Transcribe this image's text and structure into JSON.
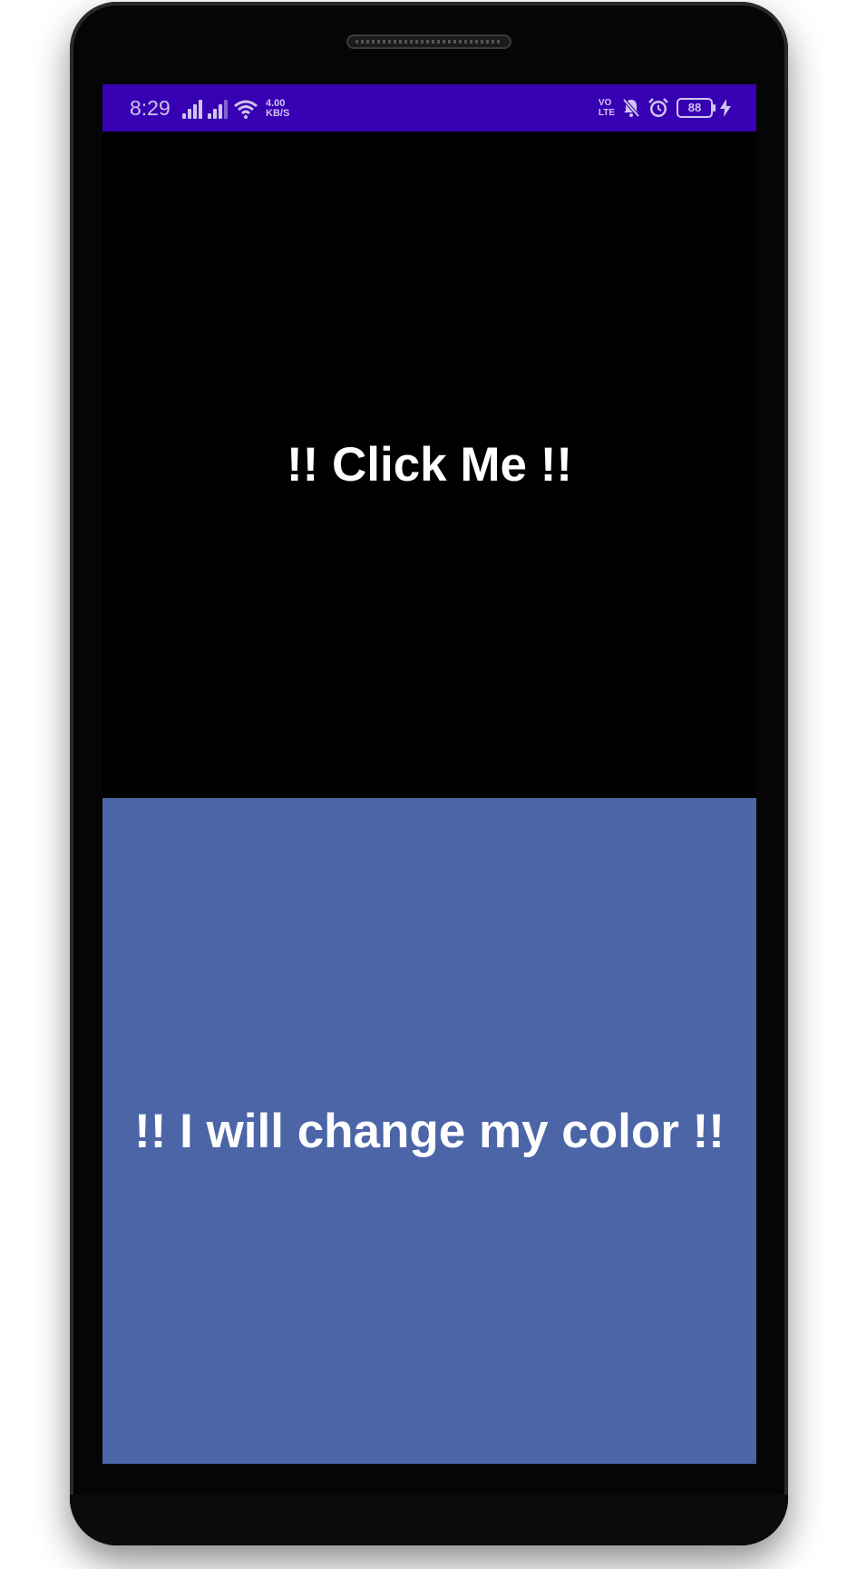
{
  "status_bar": {
    "time": "8:29",
    "net_speed_value": "4.00",
    "net_speed_unit": "KB/S",
    "volte_line1": "VO",
    "volte_line2": "LTE",
    "battery_level": "88",
    "icons": [
      "signal-icon",
      "signal-icon",
      "wifi-icon",
      "volte-icon",
      "mute-bell-icon",
      "alarm-icon",
      "battery-icon",
      "charging-icon"
    ],
    "background_color": "#3700b3"
  },
  "main": {
    "click_me_label": "!! Click Me !!",
    "color_box_label": "!! I will change my color !!",
    "color_box_color": "#4c65a7",
    "top_area_color": "#000000"
  }
}
